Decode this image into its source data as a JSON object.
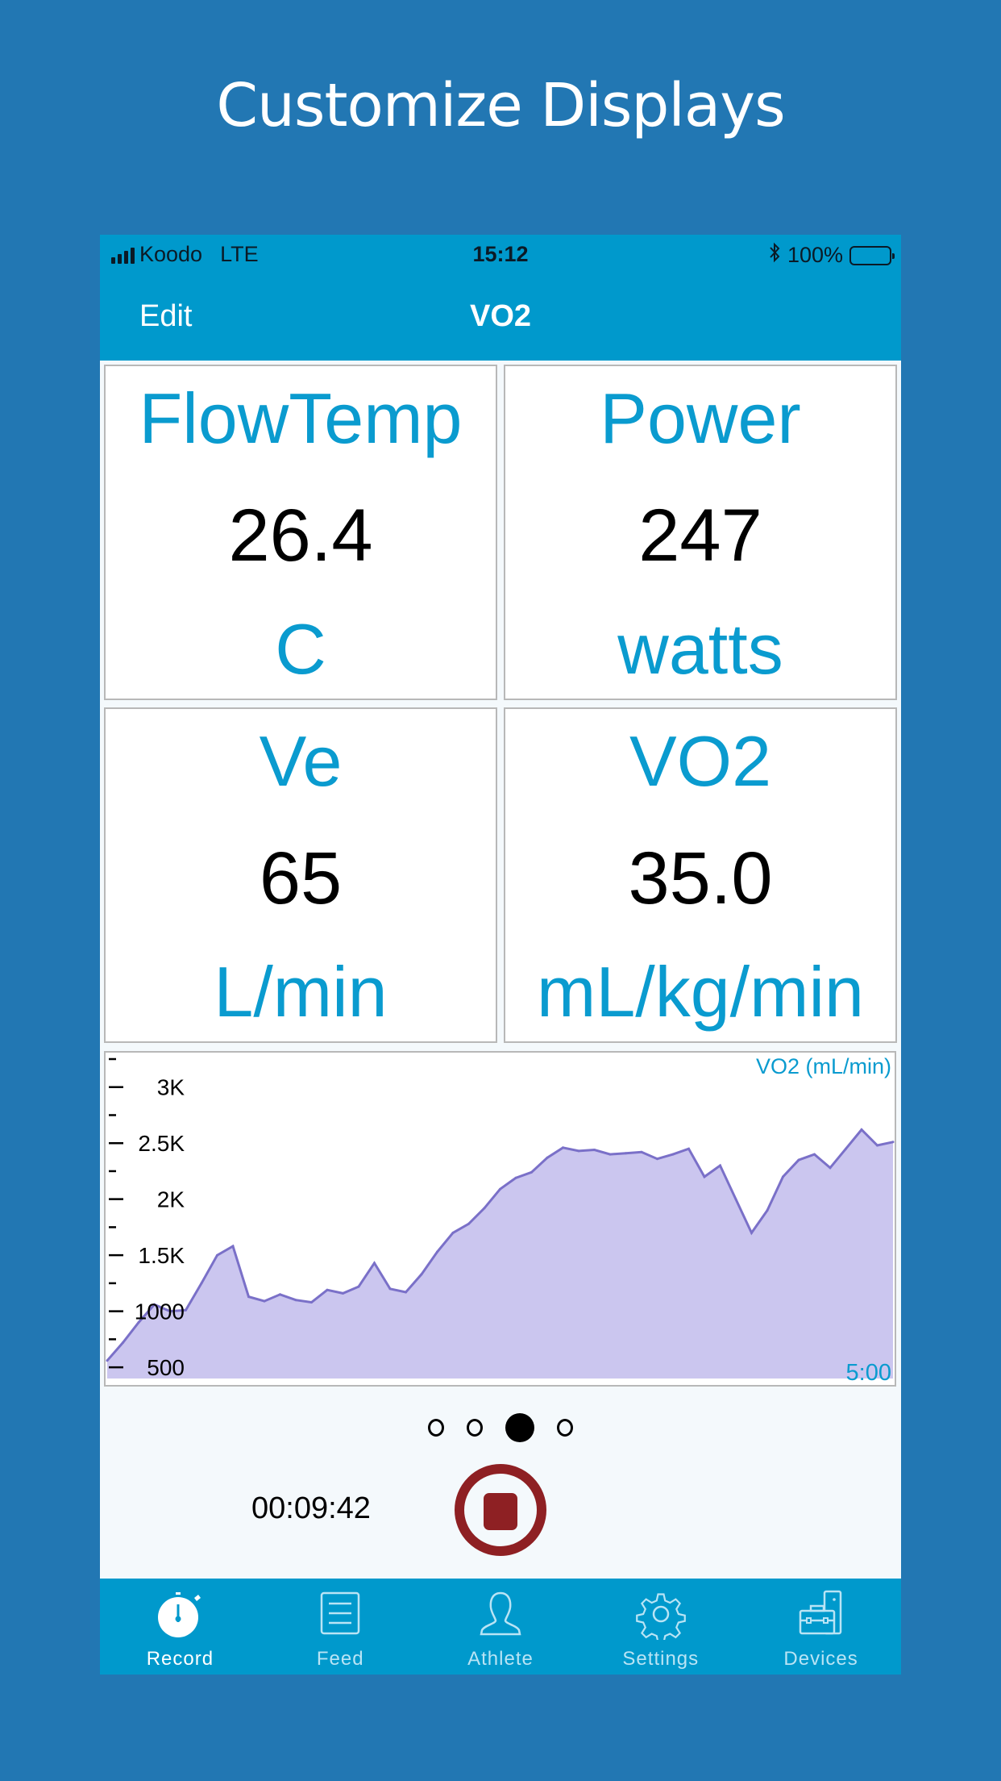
{
  "promo": {
    "title": "Customize Displays"
  },
  "status_bar": {
    "carrier": "Koodo",
    "network": "LTE",
    "time": "15:12",
    "battery": "100%"
  },
  "nav": {
    "edit_label": "Edit",
    "title": "VO2"
  },
  "cards": [
    {
      "name": "FlowTemp",
      "value": "26.4",
      "unit": "C"
    },
    {
      "name": "Power",
      "value": "247",
      "unit": "watts"
    },
    {
      "name": "Ve",
      "value": "65",
      "unit": "L/min"
    },
    {
      "name": "VO2",
      "value": "35.0",
      "unit": "mL/kg/min"
    }
  ],
  "chart_data": {
    "type": "area",
    "title": "VO2 (mL/min)",
    "x_label_right": "5:00",
    "ylabel": "",
    "ylim": [
      400,
      3250
    ],
    "y_ticks": [
      500,
      1000,
      1500,
      2000,
      2500,
      3000
    ],
    "y_tick_labels": [
      "500",
      "1000",
      "1.5K",
      "2K",
      "2.5K",
      "3K"
    ],
    "grid": false,
    "x": [
      0,
      2,
      4,
      6,
      8,
      10,
      12,
      14,
      16,
      18,
      20,
      22,
      24,
      26,
      28,
      30,
      32,
      34,
      36,
      38,
      40,
      42,
      44,
      46,
      48,
      50,
      52,
      54,
      56,
      58,
      60,
      62,
      64,
      66,
      68,
      70,
      72,
      74,
      76,
      78,
      80,
      82,
      84,
      86,
      88,
      90,
      92,
      94,
      96,
      98,
      100
    ],
    "values": [
      560,
      720,
      900,
      1060,
      1000,
      1010,
      1250,
      1500,
      1580,
      1130,
      1090,
      1150,
      1100,
      1080,
      1190,
      1160,
      1220,
      1430,
      1200,
      1170,
      1330,
      1530,
      1700,
      1780,
      1920,
      2090,
      2190,
      2240,
      2370,
      2460,
      2430,
      2440,
      2400,
      2410,
      2420,
      2360,
      2400,
      2450,
      2200,
      2300,
      2000,
      1700,
      1900,
      2200,
      2350,
      2400,
      2280,
      2450,
      2620,
      2480,
      2510
    ],
    "line_color": "#7a70c8",
    "fill_color": "#cbc6ef",
    "label_color": "#0a9bcf"
  },
  "pager": {
    "count": 4,
    "active_index": 2
  },
  "recording": {
    "elapsed": "00:09:42",
    "stop_label": "Stop"
  },
  "tabbar": {
    "items": [
      {
        "label": "Record",
        "icon": "stopwatch-icon",
        "active": true
      },
      {
        "label": "Feed",
        "icon": "feed-list-icon",
        "active": false
      },
      {
        "label": "Athlete",
        "icon": "person-icon",
        "active": false
      },
      {
        "label": "Settings",
        "icon": "gear-icon",
        "active": false
      },
      {
        "label": "Devices",
        "icon": "devices-toolbox-icon",
        "active": false
      }
    ]
  }
}
